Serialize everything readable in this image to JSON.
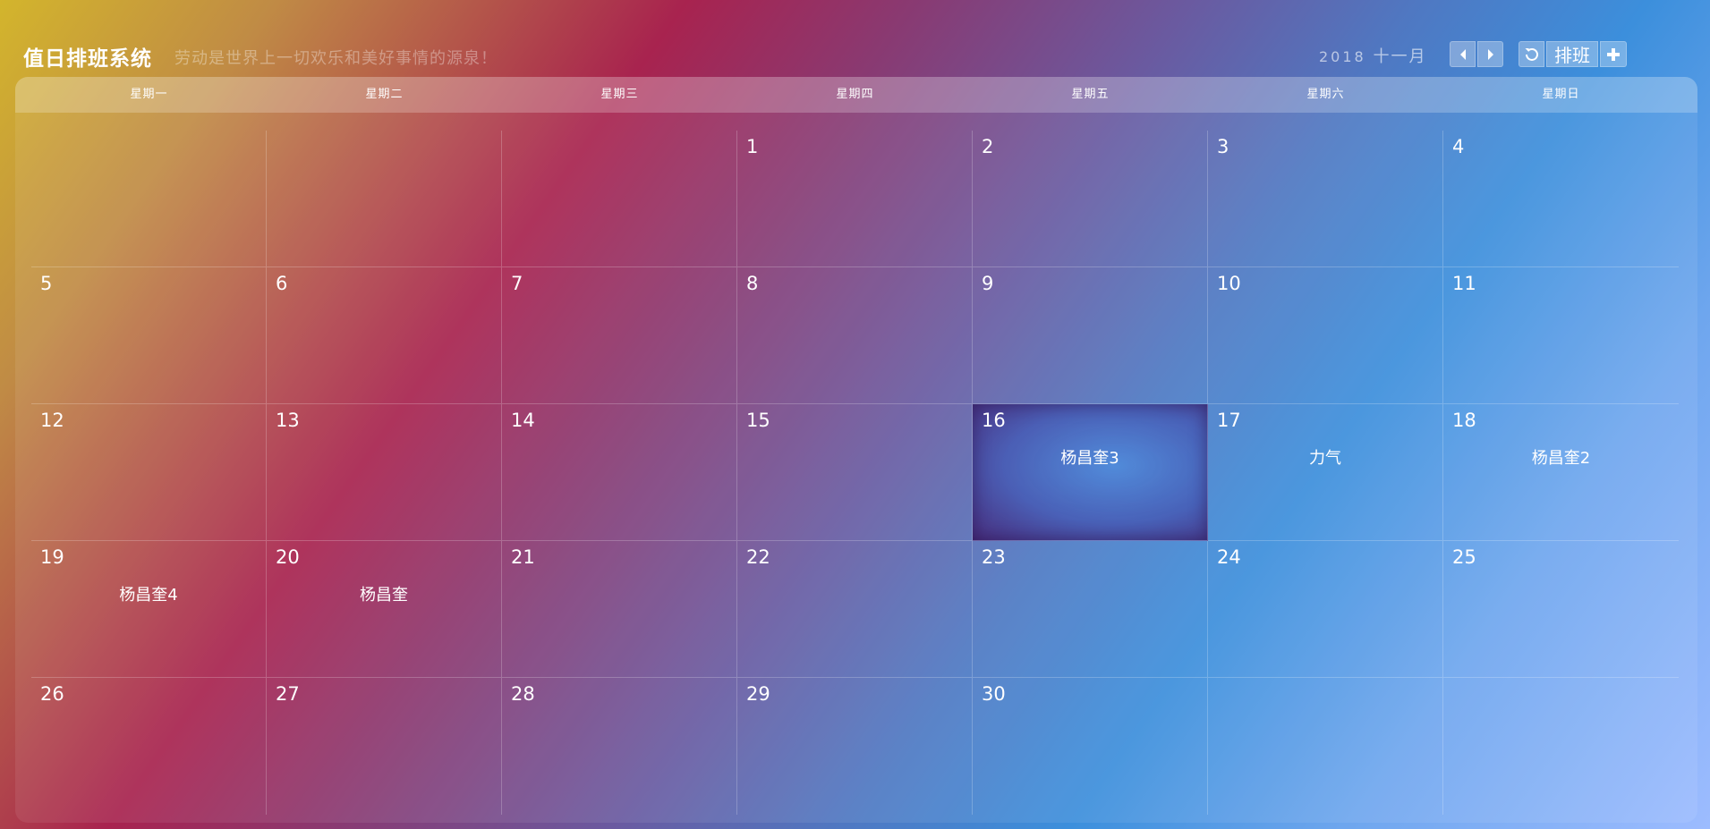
{
  "header": {
    "title": "值日排班系统",
    "slogan": "劳动是世界上一切欢乐和美好事情的源泉！",
    "year": "2018",
    "month": "十一月",
    "schedule_label": "排班"
  },
  "icons": {
    "prev": "triangle-left-icon",
    "next": "triangle-right-icon",
    "refresh": "refresh-icon",
    "add": "plus-icon"
  },
  "weekdays": [
    "星期一",
    "星期二",
    "星期三",
    "星期四",
    "星期五",
    "星期六",
    "星期日"
  ],
  "weeks": [
    [
      {
        "day": ""
      },
      {
        "day": ""
      },
      {
        "day": ""
      },
      {
        "day": "1"
      },
      {
        "day": "2"
      },
      {
        "day": "3"
      },
      {
        "day": "4"
      }
    ],
    [
      {
        "day": "5"
      },
      {
        "day": "6"
      },
      {
        "day": "7"
      },
      {
        "day": "8"
      },
      {
        "day": "9"
      },
      {
        "day": "10"
      },
      {
        "day": "11"
      }
    ],
    [
      {
        "day": "12"
      },
      {
        "day": "13"
      },
      {
        "day": "14"
      },
      {
        "day": "15"
      },
      {
        "day": "16",
        "duty": "杨昌奎3",
        "today": true
      },
      {
        "day": "17",
        "duty": "力气"
      },
      {
        "day": "18",
        "duty": "杨昌奎2"
      }
    ],
    [
      {
        "day": "19",
        "duty": "杨昌奎4"
      },
      {
        "day": "20",
        "duty": "杨昌奎"
      },
      {
        "day": "21"
      },
      {
        "day": "22"
      },
      {
        "day": "23"
      },
      {
        "day": "24"
      },
      {
        "day": "25"
      }
    ],
    [
      {
        "day": "26"
      },
      {
        "day": "27"
      },
      {
        "day": "28"
      },
      {
        "day": "29"
      },
      {
        "day": "30"
      },
      {
        "day": ""
      },
      {
        "day": ""
      }
    ]
  ]
}
